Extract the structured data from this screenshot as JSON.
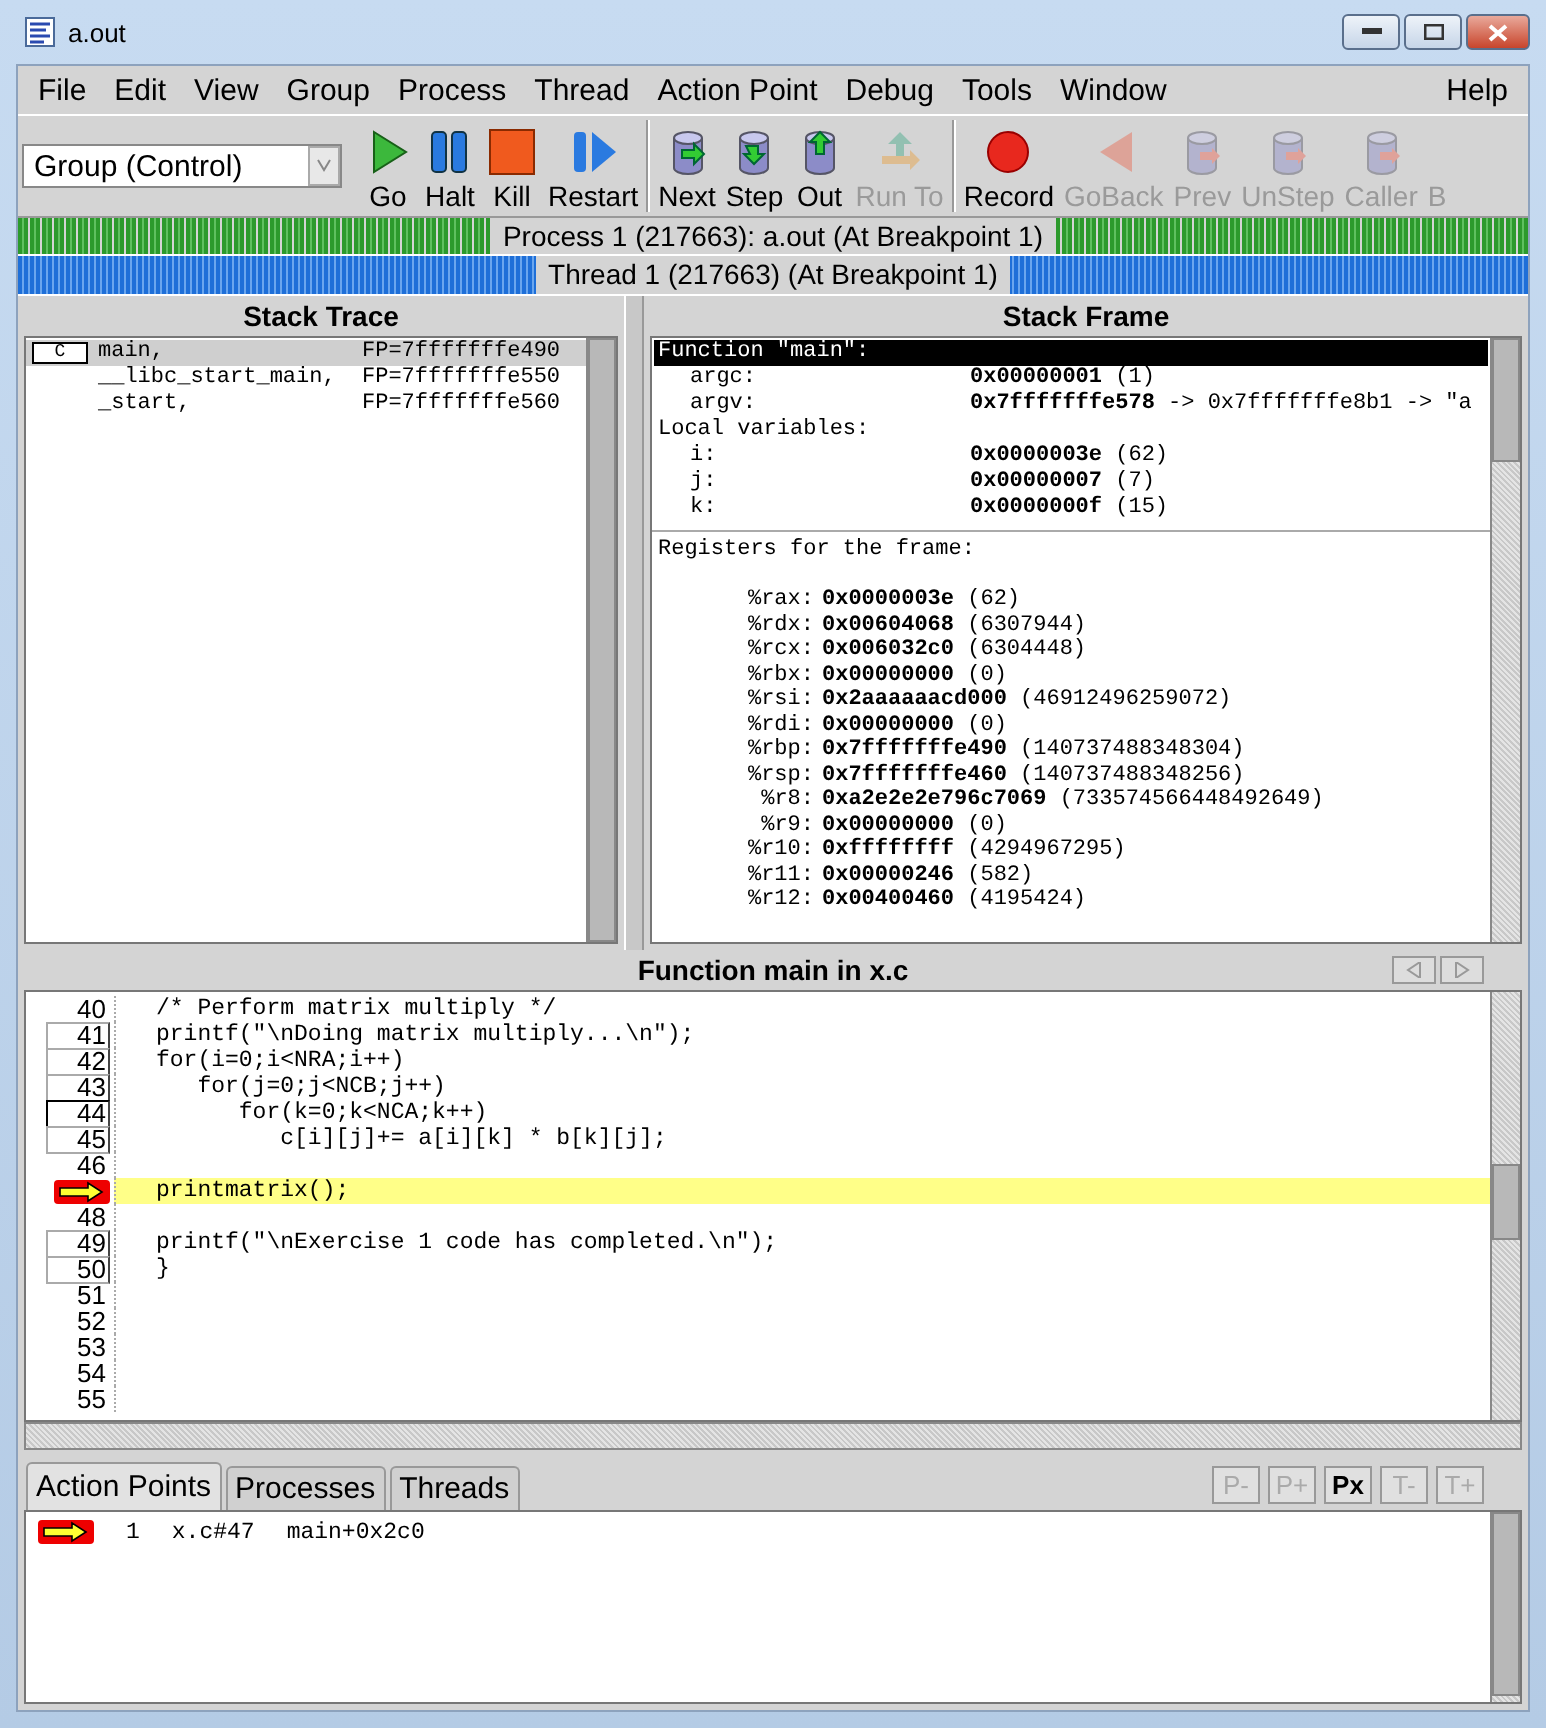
{
  "window": {
    "title": "a.out"
  },
  "menu": {
    "items": [
      {
        "label": "File"
      },
      {
        "label": "Edit"
      },
      {
        "label": "View"
      },
      {
        "label": "Group"
      },
      {
        "label": "Process"
      },
      {
        "label": "Thread"
      },
      {
        "label": "Action Point"
      },
      {
        "label": "Debug"
      },
      {
        "label": "Tools"
      },
      {
        "label": "Window"
      }
    ],
    "help": "Help"
  },
  "toolbar": {
    "group_selector": "Group (Control)",
    "groups": [
      {
        "buttons": [
          {
            "label": "Go",
            "enabled": true
          },
          {
            "label": "Halt",
            "enabled": true
          },
          {
            "label": "Kill",
            "enabled": true
          },
          {
            "label": "Restart",
            "enabled": true
          }
        ]
      },
      {
        "buttons": [
          {
            "label": "Next",
            "enabled": true
          },
          {
            "label": "Step",
            "enabled": true
          },
          {
            "label": "Out",
            "enabled": true
          },
          {
            "label": "Run To",
            "enabled": false
          }
        ]
      },
      {
        "buttons": [
          {
            "label": "Record",
            "enabled": true
          },
          {
            "label": "GoBack",
            "enabled": false
          },
          {
            "label": "Prev",
            "enabled": false
          },
          {
            "label": "UnStep",
            "enabled": false
          },
          {
            "label": "Caller",
            "enabled": false
          },
          {
            "label": "B",
            "enabled": false
          }
        ]
      }
    ]
  },
  "process_bar": {
    "text": "Process 1 (217663): a.out (At Breakpoint 1)"
  },
  "thread_bar": {
    "text": "Thread 1 (217663) (At Breakpoint 1)"
  },
  "stack_trace": {
    "title": "Stack Trace",
    "frames": [
      {
        "lang": "C",
        "name": "main,",
        "fp": "FP=7fffffffe490",
        "selected": true
      },
      {
        "name": "__libc_start_main,",
        "fp": "FP=7fffffffe550",
        "selected": false
      },
      {
        "name": "_start,",
        "fp": "FP=7fffffffe560",
        "selected": false
      }
    ]
  },
  "stack_frame": {
    "title": "Stack Frame",
    "function": "Function \"main\":",
    "params": [
      {
        "name": "argc:",
        "hex": "0x00000001",
        "rest": "(1)"
      },
      {
        "name": "argv:",
        "hex": "0x7fffffffe578",
        "rest": "-> 0x7fffffffe8b1 -> \"a"
      }
    ],
    "locals_label": "Local variables:",
    "locals": [
      {
        "name": "i:",
        "hex": "0x0000003e",
        "rest": "(62)"
      },
      {
        "name": "j:",
        "hex": "0x00000007",
        "rest": "(7)"
      },
      {
        "name": "k:",
        "hex": "0x0000000f",
        "rest": "(15)"
      }
    ],
    "registers_label": "Registers for the frame:",
    "registers": [
      {
        "name": "%rax:",
        "hex": "0x0000003e",
        "rest": "(62)"
      },
      {
        "name": "%rdx:",
        "hex": "0x00604068",
        "rest": "(6307944)"
      },
      {
        "name": "%rcx:",
        "hex": "0x006032c0",
        "rest": "(6304448)"
      },
      {
        "name": "%rbx:",
        "hex": "0x00000000",
        "rest": "(0)"
      },
      {
        "name": "%rsi:",
        "hex": "0x2aaaaaacd000",
        "rest": "(46912496259072)"
      },
      {
        "name": "%rdi:",
        "hex": "0x00000000",
        "rest": "(0)"
      },
      {
        "name": "%rbp:",
        "hex": "0x7fffffffe490",
        "rest": "(140737488348304)"
      },
      {
        "name": "%rsp:",
        "hex": "0x7fffffffe460",
        "rest": "(140737488348256)"
      },
      {
        "name": "%r8:",
        "hex": "0xa2e2e2e796c7069",
        "rest": "(733574566448492649)"
      },
      {
        "name": "%r9:",
        "hex": "0x00000000",
        "rest": "(0)"
      },
      {
        "name": "%r10:",
        "hex": "0xffffffff",
        "rest": "(4294967295)"
      },
      {
        "name": "%r11:",
        "hex": "0x00000246",
        "rest": "(582)"
      },
      {
        "name": "%r12:",
        "hex": "0x00400460",
        "rest": "(4195424)"
      }
    ]
  },
  "source": {
    "title": "Function main in x.c",
    "lines": [
      {
        "number": "40",
        "kind": "plain",
        "code": "/* Perform matrix multiply */"
      },
      {
        "number": "41",
        "kind": "boxed",
        "code": "printf(\"\\nDoing matrix multiply...\\n\");"
      },
      {
        "number": "42",
        "kind": "boxed",
        "code": "for(i=0;i<NRA;i++)"
      },
      {
        "number": "43",
        "kind": "boxed",
        "code": "   for(j=0;j<NCB;j++)"
      },
      {
        "number": "44",
        "kind": "focused",
        "code": "      for(k=0;k<NCA;k++)"
      },
      {
        "number": "45",
        "kind": "boxed",
        "code": "         c[i][j]+= a[i][k] * b[k][j];"
      },
      {
        "number": "46",
        "kind": "plain"
      },
      {
        "kind": "pc",
        "code": "printmatrix();"
      },
      {
        "number": "48",
        "kind": "plain"
      },
      {
        "number": "49",
        "kind": "boxed",
        "code": "printf(\"\\nExercise 1 code has completed.\\n\");"
      },
      {
        "number": "50",
        "kind": "boxed",
        "code": "}"
      },
      {
        "number": "51",
        "kind": "plain"
      },
      {
        "number": "52",
        "kind": "plain"
      },
      {
        "number": "53",
        "kind": "plain"
      },
      {
        "number": "54",
        "kind": "plain"
      },
      {
        "number": "55",
        "kind": "plain"
      }
    ]
  },
  "bottom": {
    "tabs": [
      {
        "label": "Action Points",
        "selected": true
      },
      {
        "label": "Processes",
        "selected": false
      },
      {
        "label": "Threads",
        "selected": false
      }
    ],
    "buttons": [
      {
        "label": "P-",
        "enabled": false
      },
      {
        "label": "P+",
        "enabled": false
      },
      {
        "label": "Px",
        "enabled": true
      },
      {
        "label": "T-",
        "enabled": false
      },
      {
        "label": "T+",
        "enabled": false
      }
    ],
    "action_points": [
      {
        "id": "1",
        "location": "x.c#47",
        "address": "main+0x2c0"
      }
    ]
  }
}
